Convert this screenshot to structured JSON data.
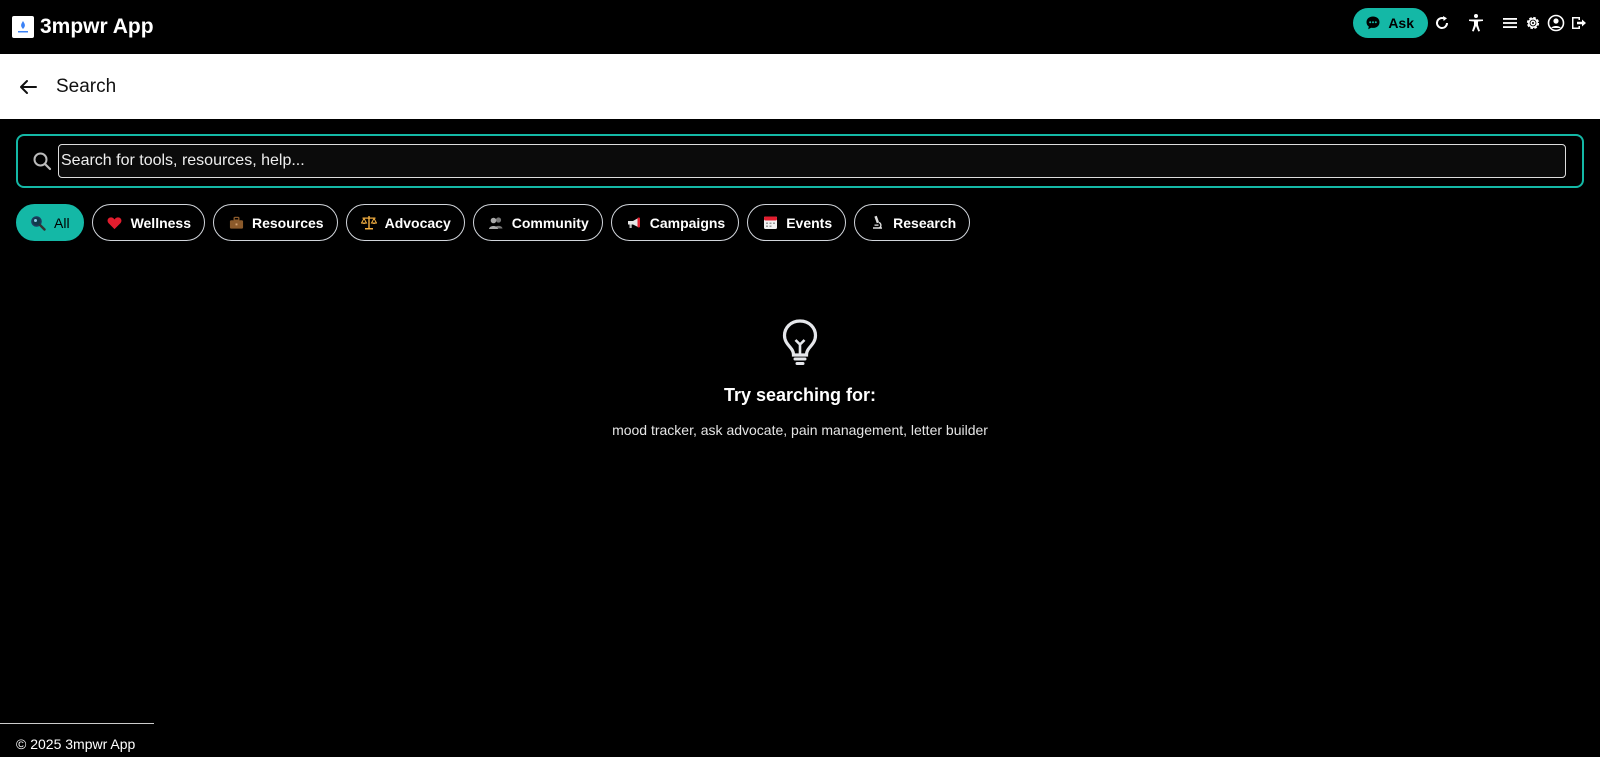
{
  "header": {
    "title": "3mpwr App",
    "ask_label": "Ask",
    "icons": [
      "chat-icon",
      "refresh-icon",
      "accessibility-icon",
      "menu-icon",
      "gear-icon",
      "user-icon",
      "logout-icon"
    ]
  },
  "subheader": {
    "title": "Search"
  },
  "search": {
    "placeholder": "Search for tools, resources, help...",
    "value": ""
  },
  "filters": [
    {
      "label": "All",
      "icon": "magnifier-icon",
      "active": true
    },
    {
      "label": "Wellness",
      "icon": "heart-icon",
      "active": false
    },
    {
      "label": "Resources",
      "icon": "briefcase-icon",
      "active": false
    },
    {
      "label": "Advocacy",
      "icon": "scales-icon",
      "active": false
    },
    {
      "label": "Community",
      "icon": "people-icon",
      "active": false
    },
    {
      "label": "Campaigns",
      "icon": "megaphone-icon",
      "active": false
    },
    {
      "label": "Events",
      "icon": "calendar-icon",
      "active": false
    },
    {
      "label": "Research",
      "icon": "microscope-icon",
      "active": false
    }
  ],
  "empty_state": {
    "title": "Try searching for:",
    "suggestions": "mood tracker, ask advocate, pain management, letter builder"
  },
  "footer": {
    "copyright": "© 2025 3mpwr App"
  },
  "colors": {
    "accent": "#14b8a6",
    "background": "#000000",
    "subheader_bg": "#ffffff"
  }
}
